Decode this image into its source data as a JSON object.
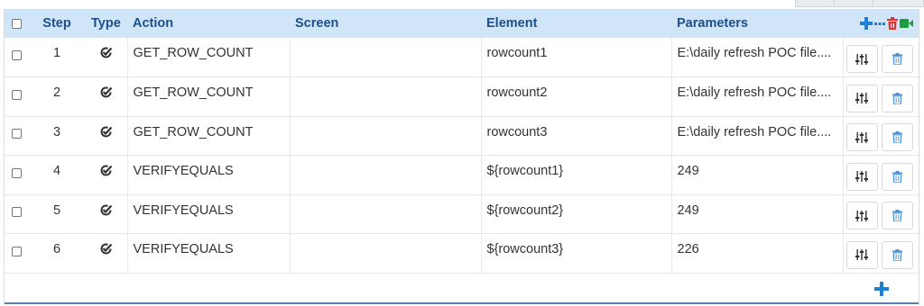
{
  "columns": {
    "step": "Step",
    "type": "Type",
    "action": "Action",
    "screen": "Screen",
    "element": "Element",
    "parameters": "Parameters"
  },
  "header_icons": [
    "add-icon",
    "more-icon",
    "delete-icon",
    "record-icon"
  ],
  "colors": {
    "header_bg": "#d0e5f7",
    "header_text": "#1c4f8d",
    "add_blue": "#1f7fd6",
    "delete_red": "#e03030",
    "record_green": "#1e9b3c",
    "row_icon_blue": "#4a90d9"
  },
  "rows": [
    {
      "step": "1",
      "type_icon": "check-icon",
      "action": "GET_ROW_COUNT",
      "screen": "",
      "element": "rowcount1",
      "parameters": "E:\\daily refresh POC file...."
    },
    {
      "step": "2",
      "type_icon": "check-icon",
      "action": "GET_ROW_COUNT",
      "screen": "",
      "element": "rowcount2",
      "parameters": "E:\\daily refresh POC file...."
    },
    {
      "step": "3",
      "type_icon": "check-icon",
      "action": "GET_ROW_COUNT",
      "screen": "",
      "element": "rowcount3",
      "parameters": "E:\\daily refresh POC file...."
    },
    {
      "step": "4",
      "type_icon": "check-icon",
      "action": "VERIFYEQUALS",
      "screen": "",
      "element": "${rowcount1}",
      "parameters": "249"
    },
    {
      "step": "5",
      "type_icon": "check-icon",
      "action": "VERIFYEQUALS",
      "screen": "",
      "element": "${rowcount2}",
      "parameters": "249"
    },
    {
      "step": "6",
      "type_icon": "check-icon",
      "action": "VERIFYEQUALS",
      "screen": "",
      "element": "${rowcount3}",
      "parameters": "226"
    }
  ],
  "row_buttons": [
    "settings-sliders-icon",
    "trash-icon"
  ],
  "footer_icon": "add-step-icon"
}
